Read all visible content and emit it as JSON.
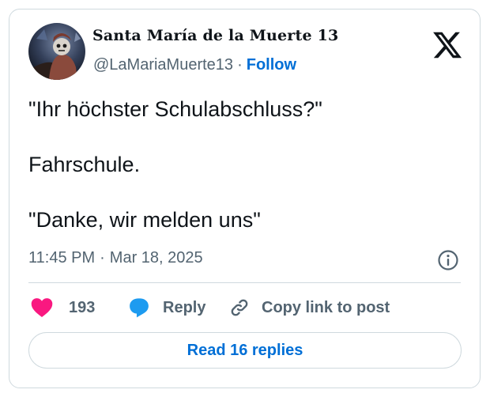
{
  "author": {
    "display_name": "Santa María de la Muerte 13",
    "handle": "@LaMariaMuerte13",
    "follow_label": "Follow"
  },
  "post": {
    "lines": [
      "\"Ihr höchster Schulabschluss?\"",
      "Fahrschule.",
      "\"Danke, wir melden uns\""
    ],
    "time": "11:45 PM",
    "date": "Mar 18, 2025"
  },
  "actions": {
    "likes": "193",
    "reply_label": "Reply",
    "copy_label": "Copy link to post"
  },
  "read_replies_label": "Read 16 replies",
  "colors": {
    "link": "#006fd6",
    "like": "#f91880",
    "reply": "#1d9bf0",
    "secondary_text": "#536471",
    "border": "#cfd9de"
  },
  "icons": [
    "x-logo-icon",
    "info-icon",
    "heart-icon",
    "reply-bubble-icon",
    "link-icon"
  ]
}
